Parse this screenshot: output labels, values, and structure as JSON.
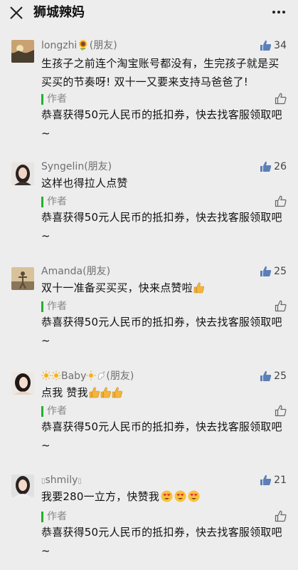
{
  "header": {
    "title": "狮城辣妈"
  },
  "comments": [
    {
      "name": "longzhi🌻(朋友)",
      "likes": "34",
      "text": "生孩子之前连个淘宝账号都没有，生完孩子就是买买买的节奏呀! 双十一又要来支持马爸爸了!",
      "author_label": "作者",
      "reply": "恭喜获得50元人民币的抵扣券，快去找客服领取吧~"
    },
    {
      "name": "Syngelin(朋友)",
      "likes": "26",
      "text": "这样也得拉人点赞",
      "author_label": "作者",
      "reply": "恭喜获得50元人民币的抵扣券，快去找客服领取吧~"
    },
    {
      "name": "Amanda(朋友)",
      "likes": "25",
      "text": "双十一准备买买买，快来点赞啦",
      "author_label": "作者",
      "reply": "恭喜获得50元人民币的抵扣券，快去找客服领取吧~"
    },
    {
      "name_prefix": "Baby",
      "name_suffix": "(朋友)",
      "likes": "25",
      "text": "点我 赞我",
      "author_label": "作者",
      "reply": "恭喜获得50元人民币的抵扣券，快去找客服领取吧~"
    },
    {
      "name": "shmily",
      "likes": "21",
      "text": "我要280一立方，快赞我",
      "author_label": "作者",
      "reply": "恭喜获得50元人民币的抵扣券，快去找客服领取吧~"
    }
  ],
  "colors": {
    "author_green": "#21b32b",
    "background": "#ededed",
    "like_icon": "#5b7fb8"
  }
}
